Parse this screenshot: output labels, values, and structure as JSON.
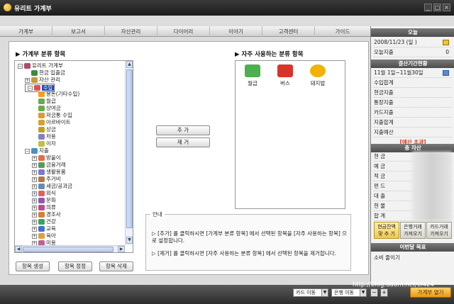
{
  "window": {
    "title": "유리트 가계부",
    "min": "_",
    "max": "□",
    "close": "×"
  },
  "tabs": [
    "가계부",
    "보고서",
    "자산관리",
    "다이어리",
    "이야기",
    "고객센터",
    "가이드"
  ],
  "main": {
    "tree_header": "▶ 가계부 분류 항목",
    "fav_header": "▶ 자주 사용하는 분류 항목",
    "tree": [
      {
        "label": "유리트 가계부",
        "level": 0,
        "exp": "−",
        "icon_color": "#b04a6a"
      },
      {
        "label": "현금 입출금",
        "level": 1,
        "exp": "",
        "icon_color": "#3d8a3d"
      },
      {
        "label": "자산 관리",
        "level": 1,
        "exp": "+",
        "icon_color": "#c79b3a"
      },
      {
        "label": "수입",
        "level": 1,
        "exp": "−",
        "icon_color": "#e05050",
        "selected": true
      },
      {
        "label": "용돈(기타수입)",
        "level": 2,
        "exp": "",
        "icon_color": "#f0a020"
      },
      {
        "label": "월급",
        "level": 2,
        "exp": "",
        "icon_color": "#6aa84f"
      },
      {
        "label": "상여금",
        "level": 2,
        "exp": "",
        "icon_color": "#6aa84f"
      },
      {
        "label": "저금통 수입",
        "level": 2,
        "exp": "",
        "icon_color": "#e09a30"
      },
      {
        "label": "아르바이트",
        "level": 2,
        "exp": "",
        "icon_color": "#d9a030"
      },
      {
        "label": "상금",
        "level": 2,
        "exp": "",
        "icon_color": "#c0a020"
      },
      {
        "label": "차용",
        "level": 2,
        "exp": "",
        "icon_color": "#8080c0"
      },
      {
        "label": "이자",
        "level": 2,
        "exp": "",
        "icon_color": "#c0c040"
      },
      {
        "label": "지출",
        "level": 1,
        "exp": "−",
        "icon_color": "#4a90c0"
      },
      {
        "label": "방울이",
        "level": 2,
        "exp": "+",
        "icon_color": "#e07040"
      },
      {
        "label": "금융거래",
        "level": 2,
        "exp": "+",
        "icon_color": "#5a9a5a"
      },
      {
        "label": "생활용품",
        "level": 2,
        "exp": "+",
        "icon_color": "#7a7ad0"
      },
      {
        "label": "주거비",
        "level": 2,
        "exp": "+",
        "icon_color": "#b07a3a"
      },
      {
        "label": "세금/공과금",
        "level": 2,
        "exp": "+",
        "icon_color": "#6a8ab0"
      },
      {
        "label": "외식",
        "level": 2,
        "exp": "+",
        "icon_color": "#e06060"
      },
      {
        "label": "문화",
        "level": 2,
        "exp": "+",
        "icon_color": "#8a5ab0"
      },
      {
        "label": "의류",
        "level": 2,
        "exp": "+",
        "icon_color": "#c04a8a"
      },
      {
        "label": "경조사",
        "level": 2,
        "exp": "+",
        "icon_color": "#d08040"
      },
      {
        "label": "건강",
        "level": 2,
        "exp": "+",
        "icon_color": "#40a060"
      },
      {
        "label": "교육",
        "level": 2,
        "exp": "+",
        "icon_color": "#4a70c0"
      },
      {
        "label": "육아",
        "level": 2,
        "exp": "+",
        "icon_color": "#e0a040"
      },
      {
        "label": "미용",
        "level": 2,
        "exp": "+",
        "icon_color": "#c06090"
      }
    ],
    "add_button": "추 가",
    "remove_button": "제 거",
    "tree_buttons": [
      "항목 생성",
      "항목 정정",
      "항목 삭제"
    ],
    "favorites": [
      {
        "label": "월급",
        "icon": "money-icon",
        "color": "#4caf50"
      },
      {
        "label": "버스",
        "icon": "bus-icon",
        "color": "#d9342b"
      },
      {
        "label": "돼지밥",
        "icon": "pig-icon",
        "color": "#f0b400"
      }
    ],
    "info": {
      "legend": "안내",
      "line1": "▷ [추가] 를 클릭하시면 [가계부 분류 항목] 에서 선택된 항목을 [자주 사용하는 항목] 으로 설정합니다.",
      "line2": "▷ [제거] 를 클릭하시면 [자주 사용하는 분류 항목] 에서 선택된 항목을 제거합니다."
    }
  },
  "right": {
    "today_header": "오늘",
    "date": "2008/11/23 (일 )",
    "today_spend_label": "오늘지출",
    "today_spend_value": "0",
    "settle_header": "결산기간현황",
    "period": "11월 1일~11월30일",
    "settle_rows": [
      "수입합계",
      "현금지출",
      "통장지출",
      "카드지출",
      "지출합계",
      "지출예산"
    ],
    "over_budget": "[예산 초과]",
    "asset_header": "총 자산",
    "asset_rows": [
      "현 금",
      "예 금",
      "적 금",
      "펀 드",
      "대 출",
      "현 물",
      "합 계"
    ],
    "gbuttons": [
      {
        "line1": "현금잔액",
        "line2": "맞 추 기"
      },
      {
        "line1": "은행거래",
        "line2": "가져오기"
      },
      {
        "line1": "카드거래",
        "line2": "가져오기"
      }
    ],
    "goal_header": "이번달 목표",
    "goal_text": "소비 줄이기"
  },
  "bottom": {
    "card_select": "카드 이동",
    "bank_select": "은행 이동",
    "minus": "−",
    "plus": "+",
    "watermark": "http://blog.daum.net/ul424",
    "go_button": "가계부 열기"
  }
}
